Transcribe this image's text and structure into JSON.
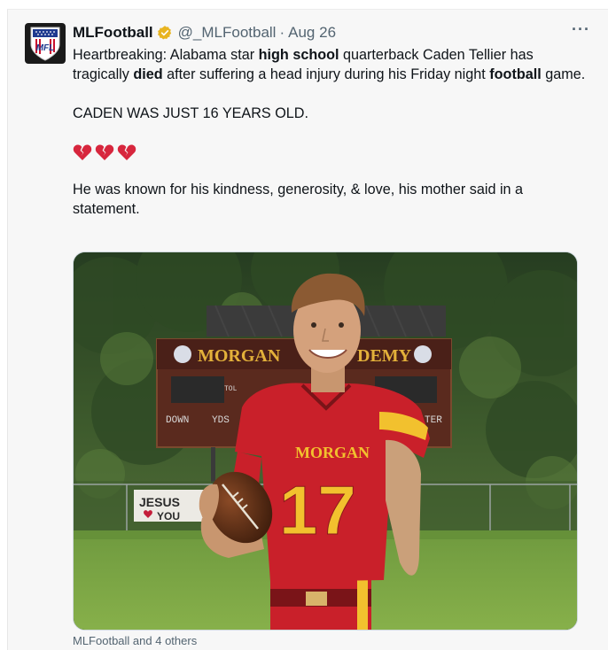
{
  "tweet": {
    "display_name": "MLFootball",
    "handle": "@_MLFootball",
    "separator": "·",
    "date": "Aug 26",
    "more_label": "···",
    "avatar_text": "MFL",
    "body": {
      "p1_a": "Heartbreaking: Alabama star ",
      "p1_hl1": "high school",
      "p1_b": " quarterback Caden Tellier has tragically ",
      "p1_hl2": "died",
      "p1_c": " after suffering a head injury during his Friday night ",
      "p1_hl3": "football",
      "p1_d": " game.",
      "p2": "CADEN WAS JUST 16 YEARS OLD.",
      "emojis": [
        "broken-heart",
        "broken-heart",
        "broken-heart"
      ],
      "p3": "He was known for his kindness, generosity, & love, his mother said in a statement."
    },
    "media": {
      "scoreboard_text": "MORGAN ACADEMY",
      "scoreboard_visible_left": "MORGAN",
      "scoreboard_visible_right": "DEMY",
      "scoreboard_labels": [
        "DOWN",
        "YDS",
        "TOL",
        "TER"
      ],
      "banner_text": "JESUS",
      "banner_text2": "YOU",
      "jersey_text": "MORGAN",
      "jersey_number": "17"
    },
    "tagged": "MLFootball and 4 others"
  },
  "colors": {
    "verified": "#e8b420",
    "jersey_red": "#c9202a",
    "jersey_gold": "#f2c12e",
    "text_secondary": "#536471"
  }
}
